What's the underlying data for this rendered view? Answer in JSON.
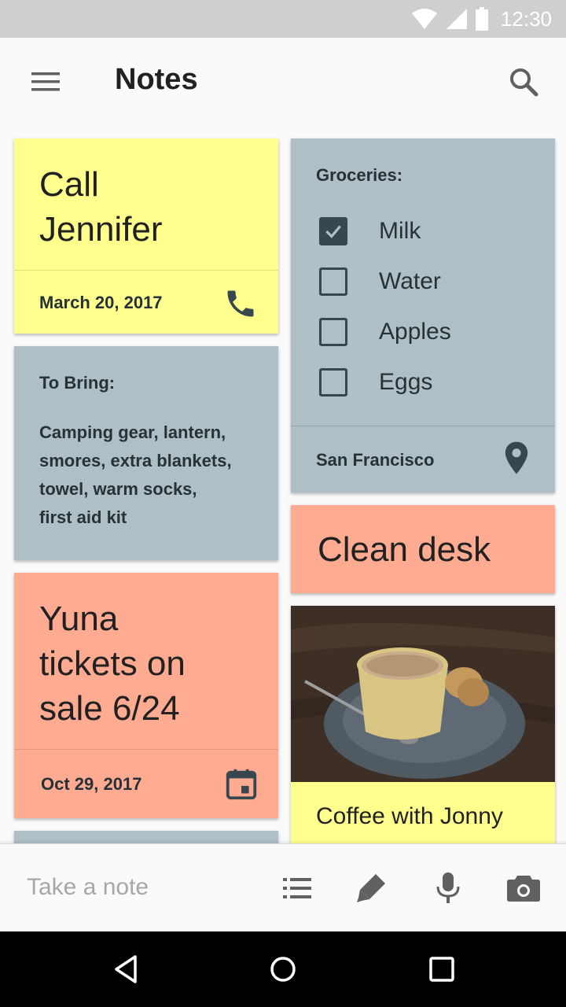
{
  "status_bar": {
    "time": "12:30"
  },
  "app_bar": {
    "title": "Notes"
  },
  "notes": [
    {
      "type": "text",
      "color": "#ffff8d",
      "title_lines": [
        "Call",
        "Jennifer"
      ],
      "footer": "March 20, 2017",
      "footer_icon": "phone-icon"
    },
    {
      "type": "text",
      "color": "#b0bec5",
      "heading": "To Bring:",
      "body_lines": [
        "Camping gear, lantern,",
        "smores, extra blankets,",
        "towel, warm socks,",
        "first aid kit"
      ]
    },
    {
      "type": "text",
      "color": "#ffab91",
      "title_lines": [
        "Yuna",
        "tickets on",
        "sale 6/24"
      ],
      "footer": "Oct 29, 2017",
      "footer_icon": "calendar-icon"
    },
    {
      "type": "checklist",
      "color": "#b0bec5",
      "heading": "Groceries:",
      "items": [
        {
          "label": "Milk",
          "checked": true
        },
        {
          "label": "Water",
          "checked": false
        },
        {
          "label": "Apples",
          "checked": false
        },
        {
          "label": "Eggs",
          "checked": false
        }
      ],
      "footer": "San Francisco",
      "footer_icon": "location-pin-icon"
    },
    {
      "type": "text",
      "color": "#ffab91",
      "title": "Clean desk"
    },
    {
      "type": "image",
      "color": "#ffff8d",
      "image": "coffee-cup-photo",
      "caption": "Coffee with Jonny"
    }
  ],
  "bottom_bar": {
    "placeholder": "Take a note",
    "actions": [
      "list-icon",
      "pen-icon",
      "microphone-icon",
      "camera-icon"
    ]
  },
  "nav_bar": {
    "buttons": [
      "back-icon",
      "home-icon",
      "recents-icon"
    ]
  }
}
